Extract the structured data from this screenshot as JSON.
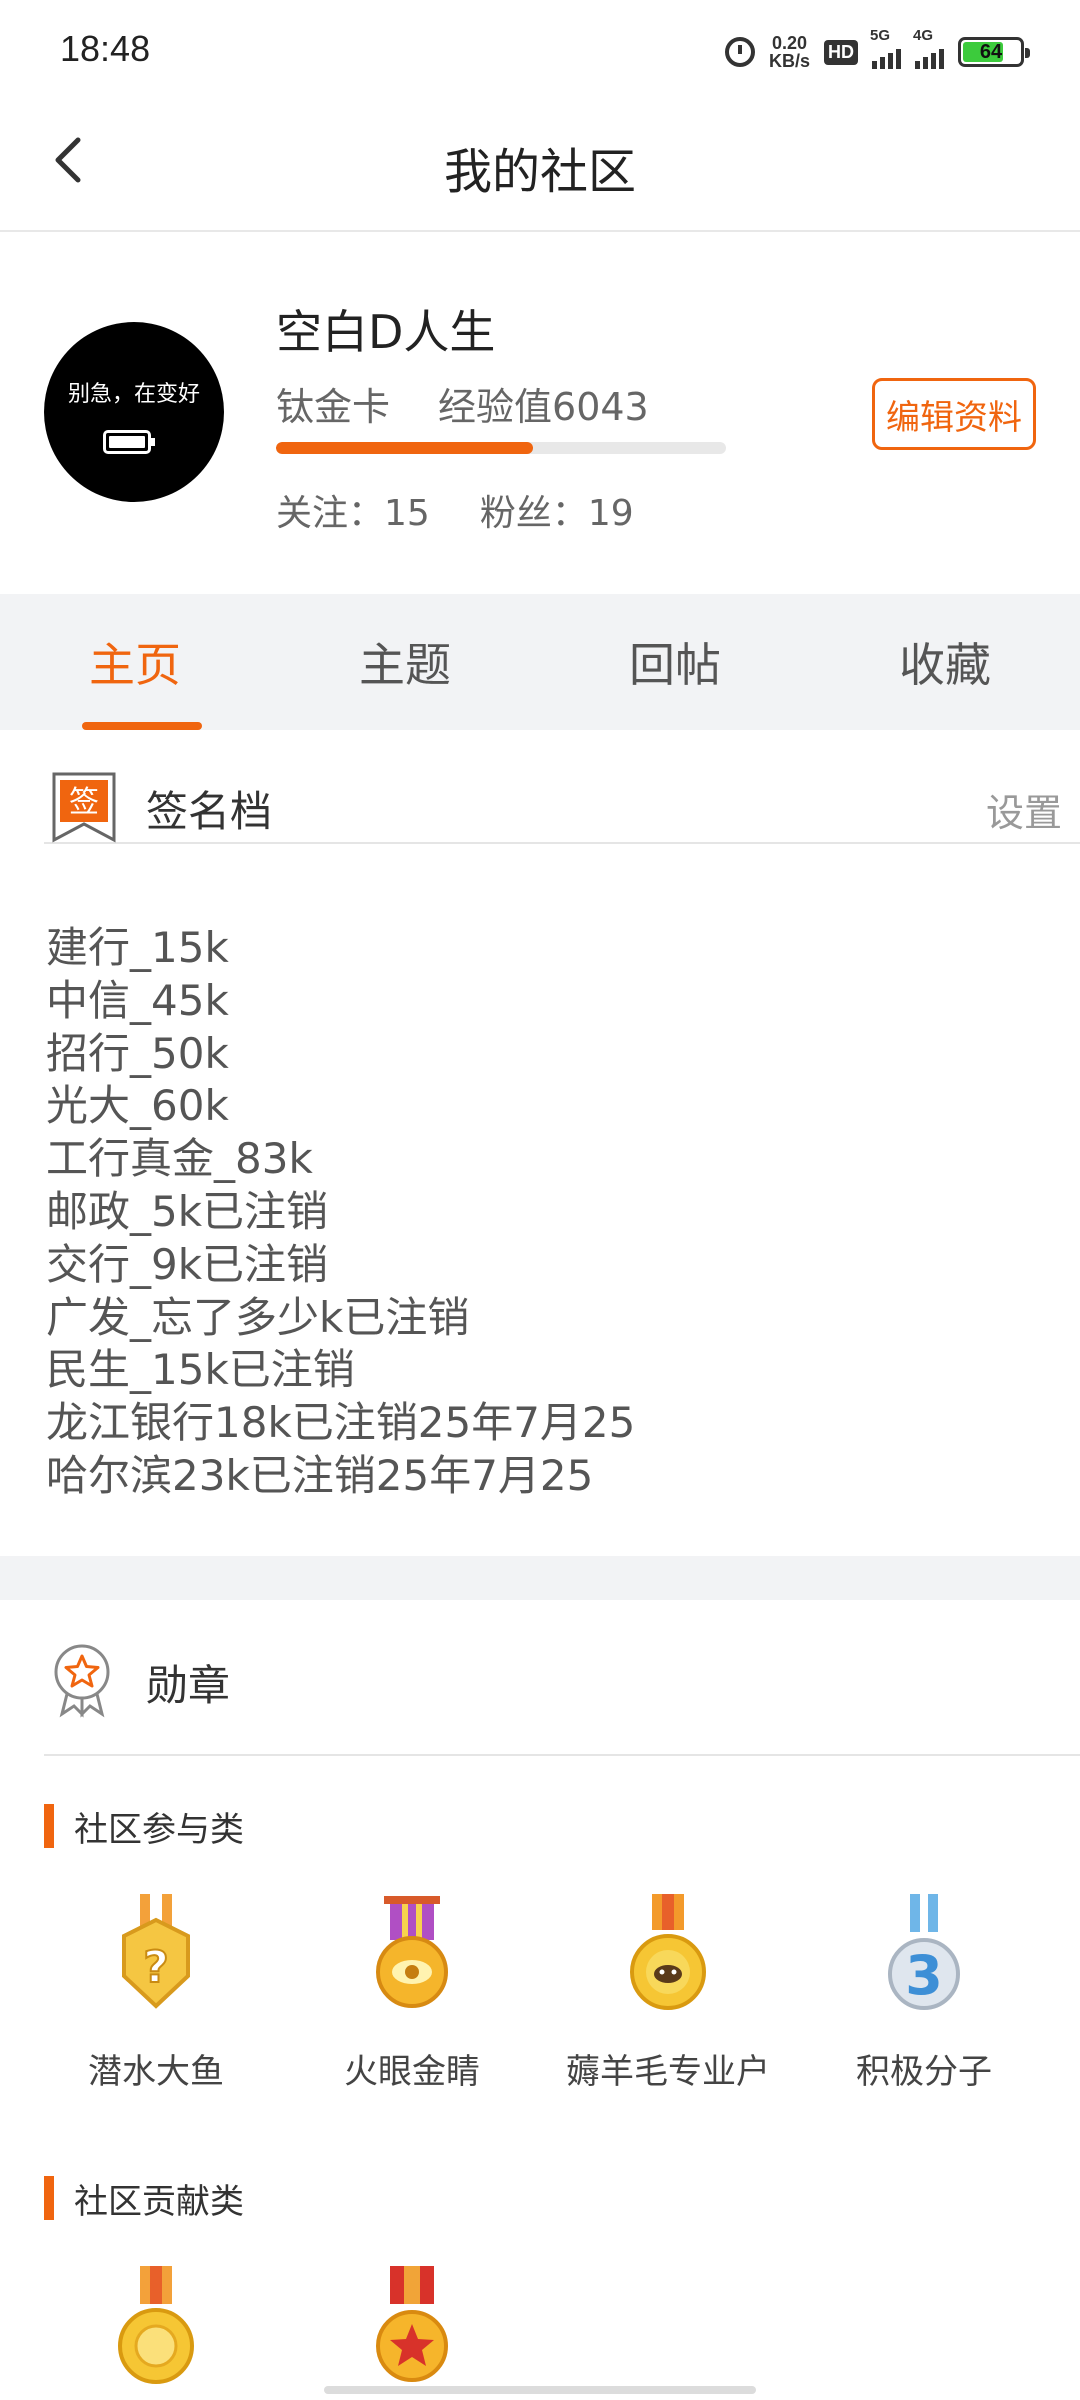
{
  "status_bar": {
    "time": "18:48",
    "net_speed_value": "0.20",
    "net_speed_unit": "KB/s",
    "hd_label": "HD",
    "signal1_label": "5G",
    "signal2_label": "4G",
    "battery_level": "64",
    "icons": [
      "alarm-icon",
      "hd-icon",
      "signal-icon",
      "battery-icon"
    ]
  },
  "nav": {
    "title": "我的社区",
    "back_icon": "chevron-left-icon"
  },
  "profile": {
    "avatar_text": "别急，在变好",
    "username": "空白D人生",
    "level": "钛金卡",
    "exp_label": "经验值6043",
    "exp_progress": 0.57,
    "following": "关注：15",
    "followers": "粉丝：19",
    "edit_button": "编辑资料"
  },
  "tabs": [
    "主页",
    "主题",
    "回帖",
    "收藏"
  ],
  "active_tab": 0,
  "signature": {
    "icon_char": "签",
    "title": "签名档",
    "action": "设置",
    "lines": [
      "建行_15k",
      "中信_45k",
      "招行_50k",
      "光大_60k",
      "工行真金_83k",
      "邮政_5k已注销",
      "交行_9k已注销",
      "广发_忘了多少k已注销",
      "民生_15k已注销",
      "龙江银行18k已注销25年7月25",
      "哈尔滨23k已注销25年7月25"
    ]
  },
  "badges": {
    "title": "勋章",
    "categories": [
      {
        "name": "社区参与类",
        "items": [
          {
            "name": "潜水大鱼",
            "icon": "question-medal-icon"
          },
          {
            "name": "火眼金睛",
            "icon": "eye-medal-icon"
          },
          {
            "name": "薅羊毛专业户",
            "icon": "sheep-medal-icon"
          },
          {
            "name": "积极分子",
            "icon": "number-three-medal-icon"
          }
        ]
      },
      {
        "name": "社区贡献类",
        "items": [
          {
            "name": "",
            "icon": "gold-medal-icon"
          },
          {
            "name": "",
            "icon": "star-medal-icon"
          }
        ]
      }
    ]
  },
  "colors": {
    "accent": "#f0650f",
    "tab_bg": "#f2f3f5",
    "text_primary": "#333333",
    "text_secondary": "#666666"
  }
}
